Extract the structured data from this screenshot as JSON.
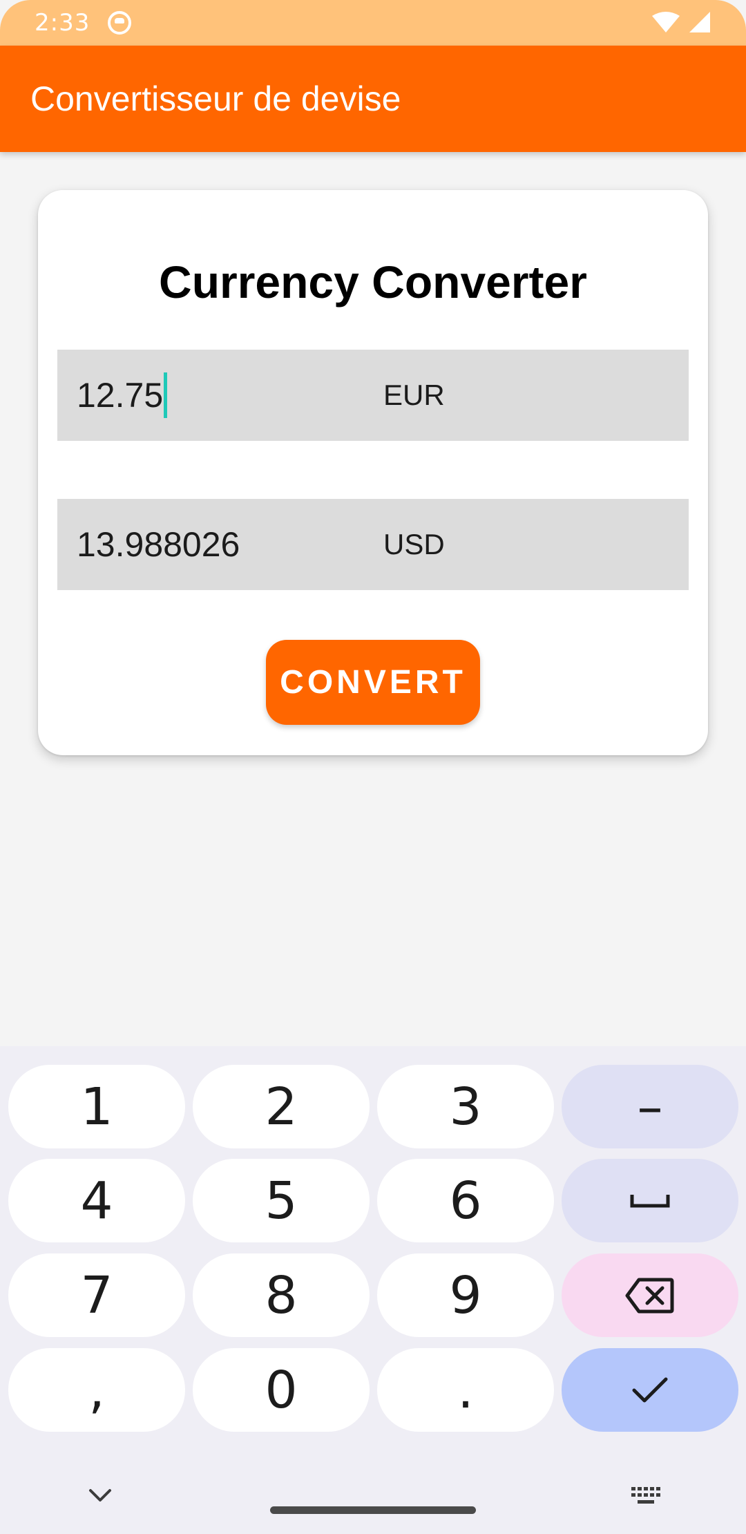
{
  "status_bar": {
    "time": "2:33"
  },
  "app_bar": {
    "title": "Convertisseur de devise"
  },
  "card": {
    "title": "Currency Converter",
    "source": {
      "value": "12.75",
      "currency": "EUR"
    },
    "target": {
      "value": "13.988026",
      "currency": "USD"
    },
    "convert_label": "CONVERT"
  },
  "keyboard": {
    "rows": [
      [
        "1",
        "2",
        "3",
        "–"
      ],
      [
        "4",
        "5",
        "6",
        "space"
      ],
      [
        "7",
        "8",
        "9",
        "backspace"
      ],
      [
        ",",
        "0",
        ".",
        "done"
      ]
    ],
    "labels": {
      "k1": "1",
      "k2": "2",
      "k3": "3",
      "minus": "–",
      "k4": "4",
      "k5": "5",
      "k6": "6",
      "k7": "7",
      "k8": "8",
      "k9": "9",
      "comma": ",",
      "k0": "0",
      "period": "."
    }
  },
  "colors": {
    "accent": "#ff6600",
    "status_bar": "#ffc27a",
    "cursor": "#1fc9b8",
    "field_bg": "#dcdcdc",
    "key_func": "#dfe0f4",
    "key_delete": "#f9d9f1",
    "key_enter": "#b4c6fb"
  },
  "icons": [
    "wifi-icon",
    "cell-signal-icon",
    "app-notification-icon",
    "space-icon",
    "backspace-icon",
    "check-icon",
    "chevron-down-icon",
    "keyboard-icon"
  ]
}
